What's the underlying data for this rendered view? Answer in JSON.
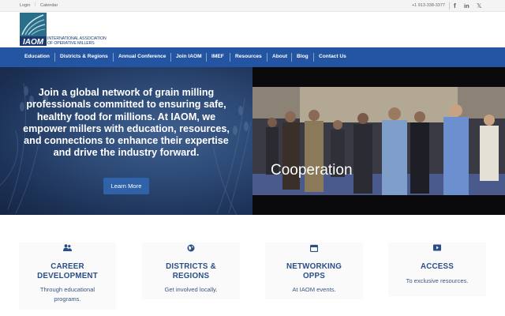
{
  "topbar": {
    "login": "Login",
    "calendar": "Calendar",
    "phone": "+1 913-338-3377",
    "social": [
      {
        "icon": "facebook-icon",
        "glyph": "f"
      },
      {
        "icon": "linkedin-icon",
        "glyph": "in"
      },
      {
        "icon": "x-icon",
        "glyph": "𝕏"
      }
    ]
  },
  "logo": {
    "abbr": "IAOM",
    "line1": "INTERNATIONAL ASSOCIATION",
    "line2": "OF OPERATIVE MILLERS"
  },
  "nav": {
    "items": [
      "Education",
      "Districts & Regions",
      "Annual Conference",
      "Join IAOM",
      "IMEF",
      "Resources",
      "About",
      "Blog",
      "Contact Us"
    ]
  },
  "hero": {
    "headline": "Join a global network of grain milling professionals committed to ensuring safe, healthy food for millions. At IAOM, we empower millers with education, resources, and connections to enhance their expertise and drive the industry forward.",
    "button": "Learn More",
    "caption": "Cooperation"
  },
  "cards": [
    {
      "icon": "people-icon",
      "title_line1": "CAREER",
      "title_line2": "DEVELOPMENT",
      "desc_line1": "Through educational",
      "desc_line2": "programs."
    },
    {
      "icon": "globe-icon",
      "title_line1": "DISTRICTS &",
      "title_line2": "REGIONS",
      "desc_line1": "Get involved locally.",
      "desc_line2": ""
    },
    {
      "icon": "calendar-icon",
      "title_line1": "NETWORKING",
      "title_line2": "OPPS",
      "desc_line1": "At IAOM events.",
      "desc_line2": ""
    },
    {
      "icon": "video-icon",
      "title_line1": "ACCESS",
      "title_line2": "",
      "desc_line1": "To exclusive resources.",
      "desc_line2": ""
    }
  ],
  "colors": {
    "nav": "#2355a2",
    "brand": "#2a4f86",
    "button": "#2f62a8"
  }
}
